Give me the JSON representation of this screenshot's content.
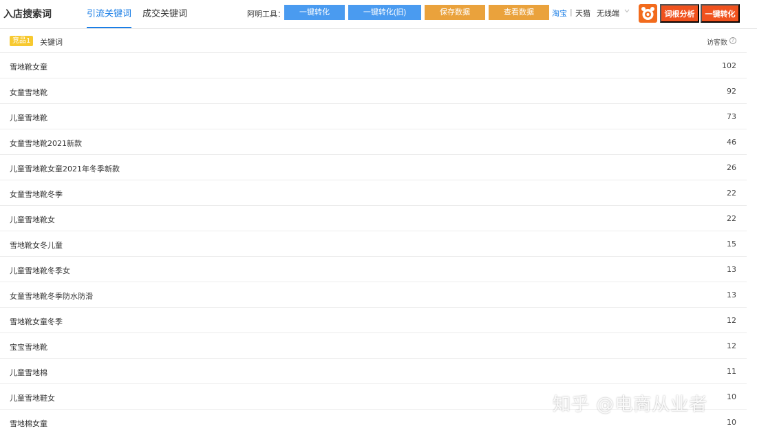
{
  "header": {
    "title": "入店搜索词",
    "tabs": [
      {
        "label": "引流关键词",
        "active": true
      },
      {
        "label": "成交关键词",
        "active": false
      }
    ],
    "tool_label": "阿明工具：",
    "tool_buttons": [
      {
        "label": "一键转化",
        "color": "#4a9bf0"
      },
      {
        "label": "一键转化(旧)",
        "color": "#4a9bf0"
      },
      {
        "label": "保存数据",
        "color": "#eaa23c"
      },
      {
        "label": "查看数据",
        "color": "#eaa23c"
      }
    ],
    "platforms": [
      "淘宝",
      "天猫"
    ],
    "platform_separator": "|",
    "device_select": "无线端",
    "action_buttons": [
      {
        "label": "词根分析",
        "color": "#f0521e"
      },
      {
        "label": "一键转化",
        "color": "#f0521e"
      }
    ]
  },
  "table": {
    "badge": "竞品1",
    "col_keyword": "关键词",
    "col_visitors": "访客数",
    "rows": [
      {
        "keyword": "雪地靴女童",
        "visitors": "102"
      },
      {
        "keyword": "女童雪地靴",
        "visitors": "92"
      },
      {
        "keyword": "儿童雪地靴",
        "visitors": "73"
      },
      {
        "keyword": "女童雪地靴2021新款",
        "visitors": "46"
      },
      {
        "keyword": "儿童雪地靴女童2021年冬季新款",
        "visitors": "26"
      },
      {
        "keyword": "女童雪地靴冬季",
        "visitors": "22"
      },
      {
        "keyword": "儿童雪地靴女",
        "visitors": "22"
      },
      {
        "keyword": "雪地靴女冬儿童",
        "visitors": "15"
      },
      {
        "keyword": "儿童雪地靴冬季女",
        "visitors": "13"
      },
      {
        "keyword": "女童雪地靴冬季防水防滑",
        "visitors": "13"
      },
      {
        "keyword": "雪地靴女童冬季",
        "visitors": "12"
      },
      {
        "keyword": "宝宝雪地靴",
        "visitors": "12"
      },
      {
        "keyword": "儿童雪地棉",
        "visitors": "11"
      },
      {
        "keyword": "儿童雪地鞋女",
        "visitors": "10"
      },
      {
        "keyword": "雪地棉女童",
        "visitors": "10"
      }
    ]
  },
  "watermark": "知乎 @电商从业者"
}
